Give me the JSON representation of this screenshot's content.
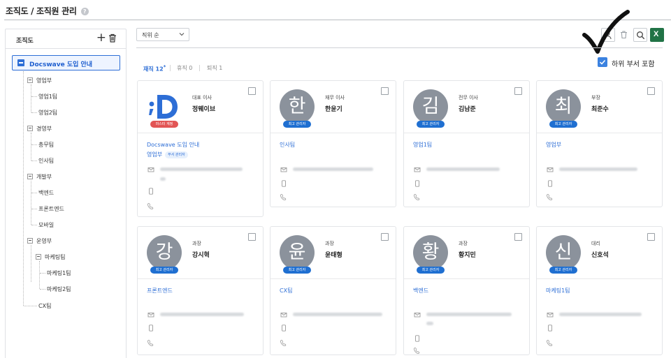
{
  "page": {
    "title": "조직도 / 조직원 관리",
    "help_icon": "?"
  },
  "sidebar": {
    "title": "조직도",
    "add_icon": "+",
    "root": "Docswave 도입 안내",
    "tree": [
      {
        "label": "영업부"
      },
      {
        "label": "영업1팀"
      },
      {
        "label": "영업2팀"
      },
      {
        "label": "경영부"
      },
      {
        "label": "총무팀"
      },
      {
        "label": "인사팀"
      },
      {
        "label": "개발부"
      },
      {
        "label": "백엔드"
      },
      {
        "label": "프론트엔드"
      },
      {
        "label": "모바일"
      },
      {
        "label": "운영부"
      },
      {
        "label": "마케팅팀"
      },
      {
        "label": "마케팅1팀"
      },
      {
        "label": "마케팅2팀"
      },
      {
        "label": "CX팀"
      }
    ]
  },
  "toolbar": {
    "sort_value": "직위 순",
    "excel_label": "X",
    "icons": [
      "user-add-icon",
      "trash-icon",
      "search-icon",
      "excel-icon"
    ]
  },
  "tabs": [
    {
      "label": "재직 12",
      "mark": "*"
    },
    {
      "label": "휴직 0"
    },
    {
      "label": "퇴직 1"
    }
  ],
  "include_subdept": {
    "label": "하위 부서 포함",
    "checked": true
  },
  "colors": {
    "accent": "#2d6ed6",
    "badge": "#1f6fd1",
    "master_badge": "#e25555",
    "avatar": "#8b929c",
    "excel": "#217346"
  },
  "cards": [
    {
      "avatar": "D",
      "badge": "마스터 계정",
      "title": "대표 이사",
      "name": "정웨이브",
      "dept": "Docswave 도입 안내",
      "subdept": "영업부",
      "subdept_badge": "부서 관리자"
    },
    {
      "avatar": "한",
      "badge": "최고 관리자",
      "title": "재무 이사",
      "name": "한윤기",
      "dept": "인사팀"
    },
    {
      "avatar": "김",
      "badge": "최고 관리자",
      "title": "전무 이사",
      "name": "김남준",
      "dept": "영업1팀"
    },
    {
      "avatar": "최",
      "badge": "최고 관리자",
      "title": "부장",
      "name": "최준수",
      "dept": "영업부"
    },
    {
      "avatar": "강",
      "badge": "최고 관리자",
      "title": "과장",
      "name": "강시혁",
      "dept": "프론트엔드"
    },
    {
      "avatar": "윤",
      "badge": "최고 관리자",
      "title": "과장",
      "name": "윤태형",
      "dept": "CX팀"
    },
    {
      "avatar": "황",
      "badge": "최고 관리자",
      "title": "과장",
      "name": "황지민",
      "dept": "백엔드"
    },
    {
      "avatar": "신",
      "badge": "최고 관리자",
      "title": "대리",
      "name": "신호석",
      "dept": "마케팅1팀"
    }
  ]
}
